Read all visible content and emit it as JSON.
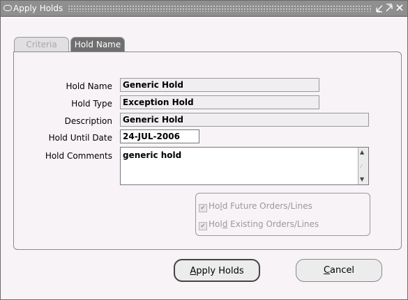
{
  "window": {
    "title": "Apply Holds"
  },
  "tabs": [
    {
      "label": "Criteria",
      "active": false
    },
    {
      "label": "Hold Name",
      "active": true
    }
  ],
  "form": {
    "hold_name": {
      "label": "Hold Name",
      "value": "Generic Hold"
    },
    "hold_type": {
      "label": "Hold Type",
      "value": "Exception Hold"
    },
    "description": {
      "label": "Description",
      "value": "Generic Hold"
    },
    "hold_until_date": {
      "label": "Hold Until Date",
      "value": "24-JUL-2006"
    },
    "hold_comments": {
      "label": "Hold Comments",
      "value": "generic hold"
    }
  },
  "checkboxes": [
    {
      "prefix": "Ho",
      "mnemonic": "l",
      "suffix": "d Future Orders/Lines",
      "checked": true,
      "enabled": false
    },
    {
      "prefix": "Hol",
      "mnemonic": "d",
      "suffix": " Existing Orders/Lines",
      "checked": true,
      "enabled": false
    }
  ],
  "buttons": {
    "apply": {
      "mnemonic": "A",
      "rest": "pply Holds"
    },
    "cancel": {
      "mnemonic": "C",
      "rest": "ancel"
    }
  },
  "icons": {
    "window_icon": "oval-window-icon",
    "minimize": "minimize-icon",
    "maximize": "maximize-icon",
    "close": "close-icon"
  }
}
